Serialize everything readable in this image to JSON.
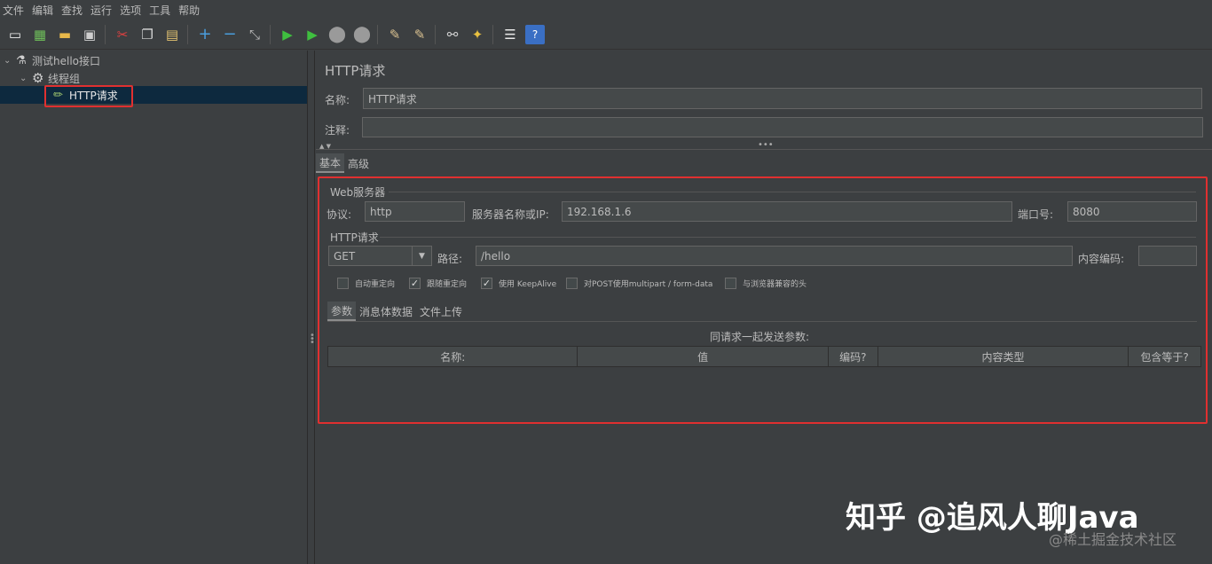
{
  "menu": [
    "文件",
    "编辑",
    "查找",
    "运行",
    "选项",
    "工具",
    "帮助"
  ],
  "toolbar_icons": [
    "new-icon",
    "templates-icon",
    "open-icon",
    "save-icon",
    "cut-icon",
    "copy-icon",
    "paste-icon",
    "expand-icon",
    "collapse-icon",
    "toggle-icon",
    "start-icon",
    "start-no-pause-icon",
    "stop-icon",
    "shutdown-icon",
    "clear-icon",
    "clear-all-icon",
    "search-icon",
    "reset-search-icon",
    "function-helper-icon",
    "help-icon"
  ],
  "tree": {
    "root": "测试hello接口",
    "thread_group": "线程组",
    "http_request": "HTTP请求"
  },
  "panel": {
    "title": "HTTP请求",
    "name_label": "名称:",
    "name_value": "HTTP请求",
    "comment_label": "注释:",
    "comment_value": "",
    "tabs": [
      "基本",
      "高级"
    ],
    "web_server": {
      "title": "Web服务器",
      "protocol_label": "协议:",
      "protocol_value": "http",
      "server_label": "服务器名称或IP:",
      "server_value": "192.168.1.6",
      "port_label": "端口号:",
      "port_value": "8080"
    },
    "http_request": {
      "title": "HTTP请求",
      "method": "GET",
      "path_label": "路径:",
      "path_value": "/hello",
      "encoding_label": "内容编码:",
      "encoding_value": ""
    },
    "checkboxes": [
      {
        "label": "自动重定向",
        "checked": false
      },
      {
        "label": "跟随重定向",
        "checked": true
      },
      {
        "label": "使用 KeepAlive",
        "checked": true
      },
      {
        "label": "对POST使用multipart / form-data",
        "checked": false
      },
      {
        "label": "与浏览器兼容的头",
        "checked": false
      }
    ],
    "sub_tabs": [
      "参数",
      "消息体数据",
      "文件上传"
    ],
    "table_caption": "同请求一起发送参数:",
    "table_headers": [
      "名称:",
      "值",
      "编码?",
      "内容类型",
      "包含等于?"
    ]
  },
  "watermark": {
    "main": "知乎 @追风人聊Java",
    "sub": "@稀土掘金技术社区"
  }
}
